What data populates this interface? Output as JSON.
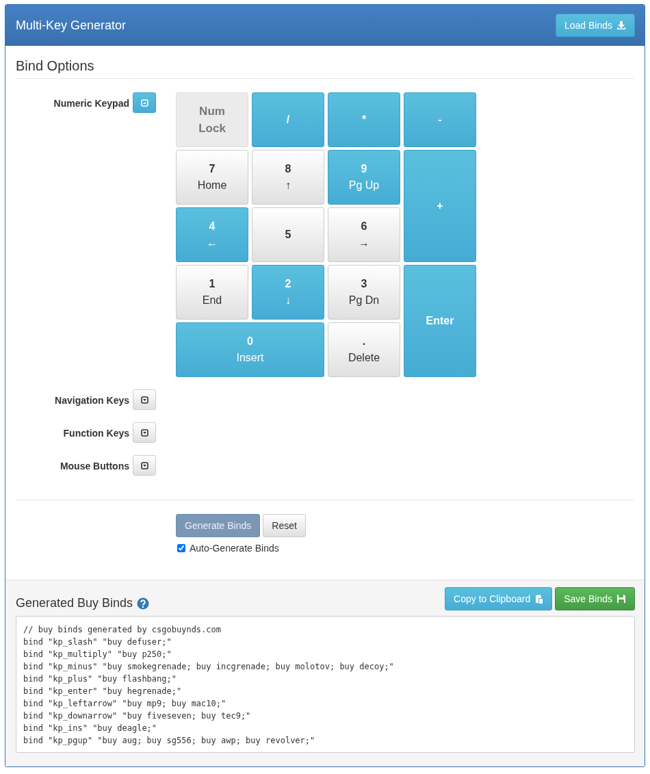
{
  "header": {
    "title": "Multi-Key Generator",
    "load_button": "Load Binds"
  },
  "bind_options": {
    "title": "Bind Options",
    "sections": [
      {
        "label": "Numeric Keypad",
        "expanded": true,
        "keys": [
          {
            "label": "Num Lock",
            "kind": "normal",
            "selected": false,
            "disabled": true
          },
          {
            "label": "/",
            "kind": "normal",
            "selected": true,
            "disabled": false
          },
          {
            "label": "*",
            "kind": "normal",
            "selected": true,
            "disabled": false
          },
          {
            "label": "-",
            "kind": "normal",
            "selected": true,
            "disabled": false
          },
          {
            "label": "7",
            "sub": "Home",
            "kind": "normal",
            "selected": false,
            "disabled": false
          },
          {
            "label": "8",
            "sub": "↑",
            "kind": "normal",
            "selected": false,
            "disabled": false
          },
          {
            "label": "9",
            "sub": "Pg Up",
            "kind": "normal",
            "selected": true,
            "disabled": false
          },
          {
            "label": "+",
            "kind": "tall",
            "selected": true,
            "disabled": false
          },
          {
            "label": "4",
            "sub": "←",
            "kind": "normal",
            "selected": true,
            "disabled": false
          },
          {
            "label": "5",
            "kind": "normal",
            "selected": false,
            "disabled": false
          },
          {
            "label": "6",
            "sub": "→",
            "kind": "normal",
            "selected": false,
            "disabled": false
          },
          {
            "label": "1",
            "sub": "End",
            "kind": "normal",
            "selected": false,
            "disabled": false
          },
          {
            "label": "2",
            "sub": "↓",
            "kind": "normal",
            "selected": true,
            "disabled": false
          },
          {
            "label": "3",
            "sub": "Pg Dn",
            "kind": "normal",
            "selected": false,
            "disabled": false
          },
          {
            "label": "Enter",
            "kind": "tall",
            "selected": true,
            "disabled": false
          },
          {
            "label": "0",
            "sub": "Insert",
            "kind": "wide",
            "selected": true,
            "disabled": false
          },
          {
            "label": ".",
            "sub": "Delete",
            "kind": "normal",
            "selected": false,
            "disabled": false
          }
        ]
      },
      {
        "label": "Navigation Keys",
        "expanded": false
      },
      {
        "label": "Function Keys",
        "expanded": false
      },
      {
        "label": "Mouse Buttons",
        "expanded": false
      }
    ],
    "generate_button": {
      "label": "Generate Binds",
      "disabled": true
    },
    "reset_button": "Reset",
    "auto_generate": {
      "label": "Auto-Generate Binds",
      "checked": true
    }
  },
  "generated": {
    "title": "Generated Buy Binds",
    "copy_button": "Copy to Clipboard",
    "save_button": "Save Binds",
    "lines": [
      "// buy binds generated by csgobuynds.com",
      "bind \"kp_slash\" \"buy defuser;\"",
      "bind \"kp_multiply\" \"buy p250;\"",
      "bind \"kp_minus\" \"buy smokegrenade; buy incgrenade; buy molotov; buy decoy;\"",
      "bind \"kp_plus\" \"buy flashbang;\"",
      "bind \"kp_enter\" \"buy hegrenade;\"",
      "bind \"kp_leftarrow\" \"buy mp9; buy mac10;\"",
      "bind \"kp_downarrow\" \"buy fiveseven; buy tec9;\"",
      "bind \"kp_ins\" \"buy deagle;\"",
      "bind \"kp_pgup\" \"buy aug; buy sg556; buy awp; buy revolver;\""
    ]
  }
}
